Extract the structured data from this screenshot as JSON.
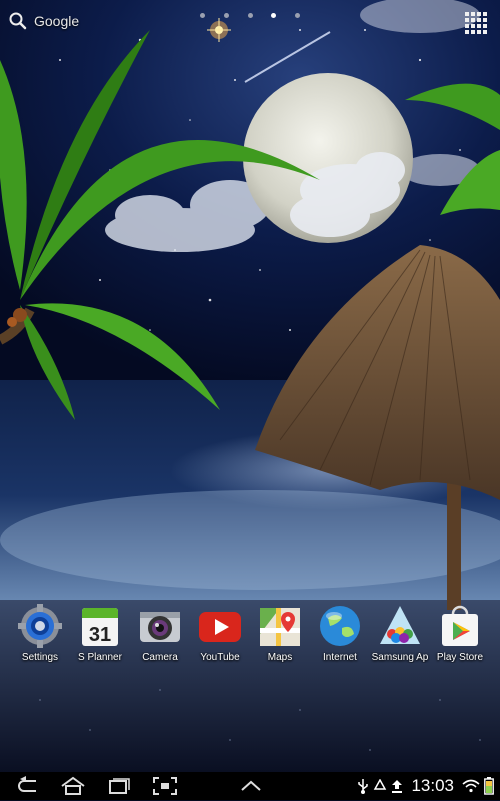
{
  "search": {
    "label": "Google"
  },
  "page_indicator": {
    "count": 5,
    "active": 3
  },
  "dock": {
    "apps": [
      {
        "label": "Settings",
        "icon": "settings-gear-icon"
      },
      {
        "label": "S Planner",
        "icon": "calendar-icon",
        "day": "31"
      },
      {
        "label": "Camera",
        "icon": "camera-icon"
      },
      {
        "label": "YouTube",
        "icon": "youtube-icon"
      },
      {
        "label": "Maps",
        "icon": "maps-icon"
      },
      {
        "label": "Internet",
        "icon": "globe-icon"
      },
      {
        "label": "Samsung Ap",
        "icon": "samsung-apps-icon"
      },
      {
        "label": "Play Store",
        "icon": "play-store-icon"
      }
    ]
  },
  "navbar": {
    "buttons": [
      "back-icon",
      "home-icon",
      "recent-apps-icon",
      "screenshot-icon",
      "up-chevron-icon"
    ]
  },
  "status": {
    "time": "13:03",
    "icons": [
      "usb-icon",
      "recycle-icon",
      "upload-icon",
      "wifi-icon",
      "battery-icon"
    ]
  },
  "colors": {
    "sky": "#0b1d4a",
    "sea": "#14264a",
    "palm": "#3f9a1f",
    "hut": "#7a5b3a",
    "youtube": "#d9261c",
    "globe": "#2a8ad9"
  }
}
